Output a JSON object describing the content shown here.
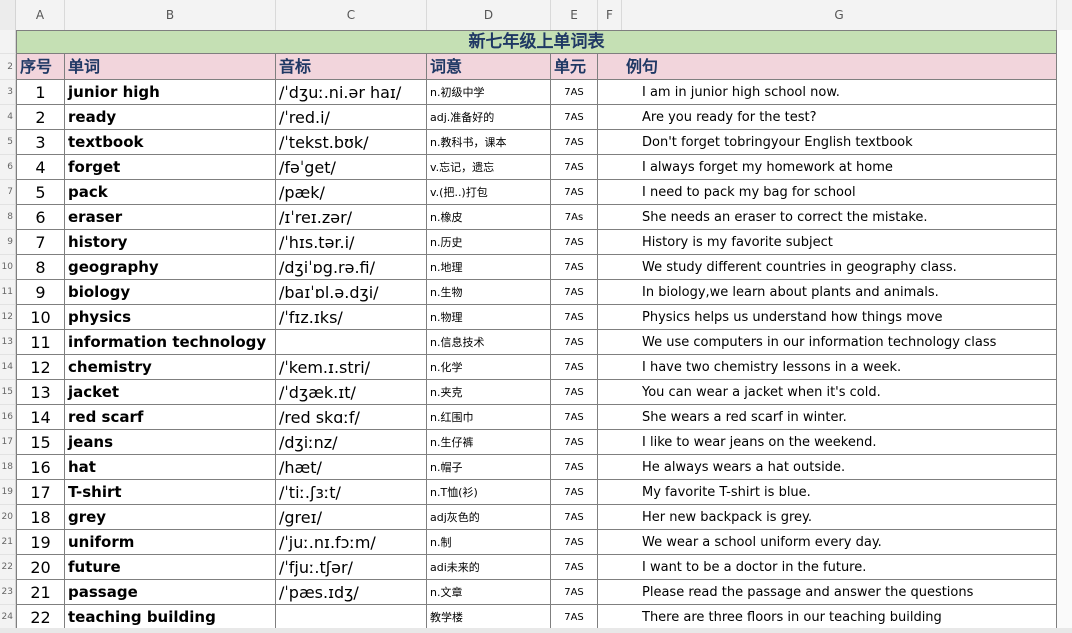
{
  "column_letters": [
    "A",
    "B",
    "C",
    "D",
    "E",
    "F",
    "G"
  ],
  "row_numbers": [
    "",
    "2",
    "3",
    "4",
    "5",
    "6",
    "7",
    "8",
    "9",
    "10",
    "11",
    "12",
    "13",
    "14",
    "15",
    "16",
    "17",
    "18",
    "19",
    "20",
    "21",
    "22",
    "23",
    "24"
  ],
  "sheet_title": "新七年级上单词表",
  "headers": {
    "no": "序号",
    "word": "单词",
    "phonetic": "音标",
    "meaning": "词意",
    "unit": "单元",
    "example": "例句"
  },
  "rows": [
    {
      "no": "1",
      "word": "junior high",
      "phonetic": "/ˈdʒuː.ni.ər haɪ/",
      "meaning": "n.初级中学",
      "unit": "7AS",
      "example": "I am in junior high school now."
    },
    {
      "no": "2",
      "word": "ready",
      "phonetic": "/ˈred.i/",
      "meaning": "adj.准备好的",
      "unit": "7AS",
      "example": "Are you ready for the test?"
    },
    {
      "no": "3",
      "word": "textbook",
      "phonetic": "/ˈtekst.bʊk/",
      "meaning": "n.教科书，课本",
      "unit": "7AS",
      "example": "Don't forget tobringyour English textbook"
    },
    {
      "no": "4",
      "word": "forget",
      "phonetic": "/fəˈget/",
      "meaning": "v.忘记，遗忘",
      "unit": "7AS",
      "example": "I always forget my homework at home"
    },
    {
      "no": "5",
      "word": "pack",
      "phonetic": "/pæk/",
      "meaning": "v.(把..)打包",
      "unit": "7AS",
      "example": "I need to pack my bag for school"
    },
    {
      "no": "6",
      "word": "eraser",
      "phonetic": "/ɪˈreɪ.zər/",
      "meaning": "n.橡皮",
      "unit": "7As",
      "example": "She needs an eraser to correct the mistake."
    },
    {
      "no": "7",
      "word": "history",
      "phonetic": "/ˈhɪs.tər.i/",
      "meaning": "n.历史",
      "unit": "7AS",
      "example": "History is my favorite subject"
    },
    {
      "no": "8",
      "word": "geography",
      "phonetic": "/dʒiˈɒg.rə.fi/",
      "meaning": "n.地理",
      "unit": "7AS",
      "example": "We study different countries in geography class."
    },
    {
      "no": "9",
      "word": "biology",
      "phonetic": "/baɪˈɒl.ə.dʒi/",
      "meaning": "n.生物",
      "unit": "7AS",
      "example": "In biology,we learn about plants and animals."
    },
    {
      "no": "10",
      "word": "physics",
      "phonetic": "/ˈfɪz.ɪks/",
      "meaning": "n.物理",
      "unit": "7AS",
      "example": "Physics helps us understand how things move"
    },
    {
      "no": "11",
      "word": "information technology",
      "phonetic": "",
      "meaning": "n.信息技术",
      "unit": "7AS",
      "example": "We use computers in our information technology class"
    },
    {
      "no": "12",
      "word": "chemistry",
      "phonetic": "/ˈkem.ɪ.stri/",
      "meaning": "n.化学",
      "unit": "7AS",
      "example": "I have two chemistry lessons in a week."
    },
    {
      "no": "13",
      "word": "jacket",
      "phonetic": "/ˈdʒæk.ɪt/",
      "meaning": "n.夹克",
      "unit": "7AS",
      "example": "You can wear a jacket when it's cold."
    },
    {
      "no": "14",
      "word": "red scarf",
      "phonetic": "/red skɑːf/",
      "meaning": "n.红围巾",
      "unit": "7AS",
      "example": "She wears a red scarf in winter."
    },
    {
      "no": "15",
      "word": "jeans",
      "phonetic": "/dʒiːnz/",
      "meaning": "n.生仔裤",
      "unit": "7AS",
      "example": "I like to wear jeans on the weekend."
    },
    {
      "no": "16",
      "word": "hat",
      "phonetic": "/hæt/",
      "meaning": "n.帽子",
      "unit": "7AS",
      "example": "He always wears a hat outside."
    },
    {
      "no": "17",
      "word": "T-shirt",
      "phonetic": "/ˈtiː.ʃɜːt/",
      "meaning": "n.T恤(衫)",
      "unit": "7AS",
      "example": "My favorite T-shirt is blue."
    },
    {
      "no": "18",
      "word": "grey",
      "phonetic": "/greɪ/",
      "meaning": "adj灰色的",
      "unit": "7AS",
      "example": "Her new backpack is grey."
    },
    {
      "no": "19",
      "word": "uniform",
      "phonetic": "/ˈjuː.nɪ.fɔːm/",
      "meaning": "n.制",
      "unit": "7AS",
      "example": "We wear a school uniform every day."
    },
    {
      "no": "20",
      "word": "future",
      "phonetic": "/ˈfjuː.tʃər/",
      "meaning": "adi未来的",
      "unit": "7AS",
      "example": "I want to be a doctor in the future."
    },
    {
      "no": "21",
      "word": "passage",
      "phonetic": "/ˈpæs.ɪdʒ/",
      "meaning": "n.文章",
      "unit": "7AS",
      "example": "Please read the passage and answer the questions"
    },
    {
      "no": "22",
      "word": "teaching building",
      "phonetic": "",
      "meaning": "教学楼",
      "unit": "7AS",
      "example": "There are three floors in our teaching building"
    }
  ]
}
